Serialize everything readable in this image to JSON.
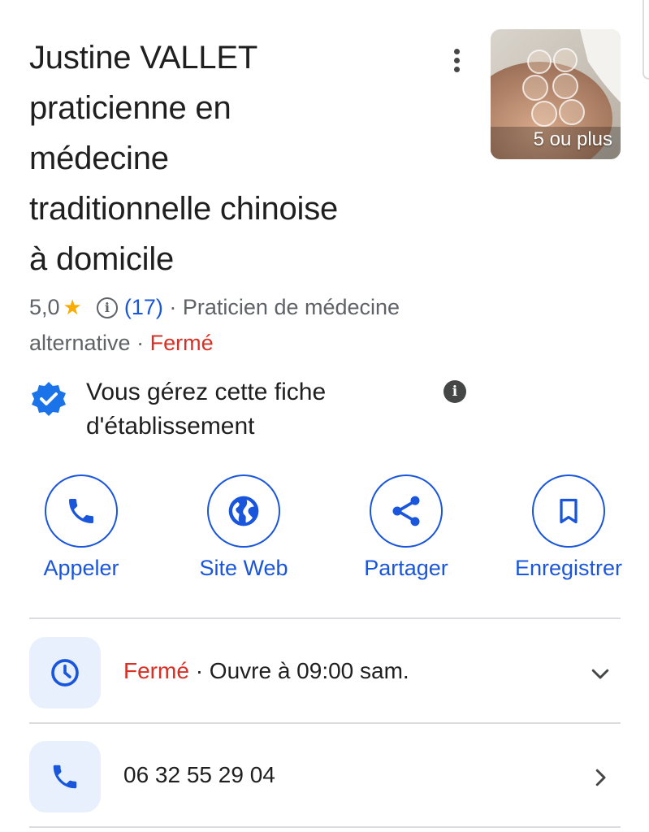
{
  "listing": {
    "title_lines": [
      "Justine VALLET",
      "praticienne en",
      "médecine",
      "traditionnelle chinoise",
      "à domicile"
    ],
    "photo_label": "5 ou plus",
    "rating": "5,0",
    "review_count": "(17)",
    "category_part1": "Praticien de médecine",
    "category_part2": "alternative",
    "separator": "·",
    "status": "Fermé"
  },
  "verified": {
    "text": "Vous gérez cette fiche d'établissement"
  },
  "actions": [
    {
      "label": "Appeler",
      "icon": "phone-icon"
    },
    {
      "label": "Site Web",
      "icon": "globe-icon"
    },
    {
      "label": "Partager",
      "icon": "share-icon"
    },
    {
      "label": "Enregistrer",
      "icon": "bookmark-icon"
    }
  ],
  "hours": {
    "status": "Fermé",
    "separator": "·",
    "next_open": "Ouvre à 09:00 sam."
  },
  "phone": {
    "number": "06 32 55 29 04"
  },
  "colors": {
    "accent": "#1a56db",
    "closed": "#d93025",
    "star": "#f9ab00",
    "icon_bg": "#e8f0fe"
  }
}
